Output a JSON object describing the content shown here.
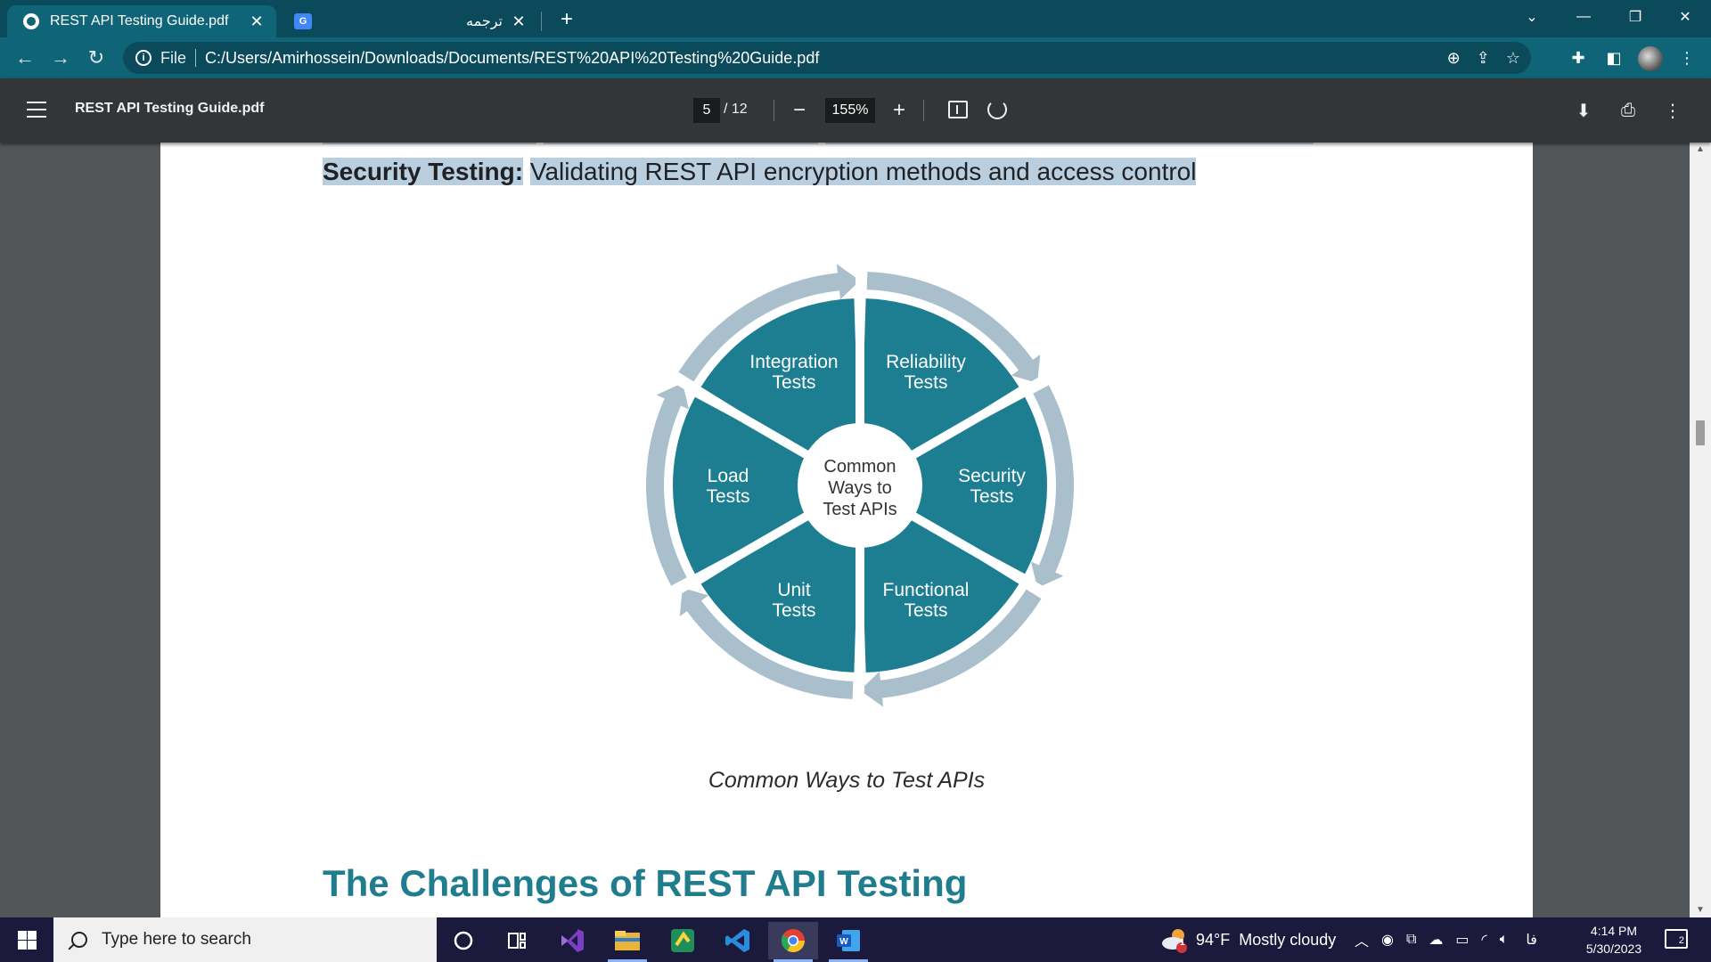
{
  "browser": {
    "tabs": [
      {
        "title": "REST API Testing Guide.pdf",
        "active": true
      },
      {
        "title": "ترجمه",
        "active": false
      }
    ],
    "address": {
      "scheme_label": "File",
      "url": "C:/Users/Amirhossein/Downloads/Documents/REST%20API%20Testing%20Guide.pdf"
    }
  },
  "pdf_viewer": {
    "title": "REST API Testing Guide.pdf",
    "current_page": "5",
    "total_pages": "/ 12",
    "zoom": "155%"
  },
  "document": {
    "security_label": "Security Testing:",
    "security_text": "Validating REST API encryption methods and access control",
    "diagram": {
      "center_lines": [
        "Common",
        "Ways to",
        "Test APIs"
      ],
      "segments": [
        {
          "lines": [
            "Integration",
            "Tests"
          ]
        },
        {
          "lines": [
            "Reliability",
            "Tests"
          ]
        },
        {
          "lines": [
            "Security",
            "Tests"
          ]
        },
        {
          "lines": [
            "Functional",
            "Tests"
          ]
        },
        {
          "lines": [
            "Unit",
            "Tests"
          ]
        },
        {
          "lines": [
            "Load",
            "Tests"
          ]
        }
      ],
      "colors": {
        "segment": "#1d7d91",
        "arrow_ring": "#a9bfcb",
        "center": "#ffffff"
      }
    },
    "caption": "Common Ways to Test APIs",
    "heading": "The Challenges of REST API Testing"
  },
  "taskbar": {
    "search_placeholder": "Type here to search",
    "weather": {
      "badge": "1",
      "temperature": "94°F",
      "condition": "Mostly cloudy"
    },
    "language": "فا",
    "time": "4:14 PM",
    "date": "5/30/2023",
    "notification_count": "2"
  }
}
